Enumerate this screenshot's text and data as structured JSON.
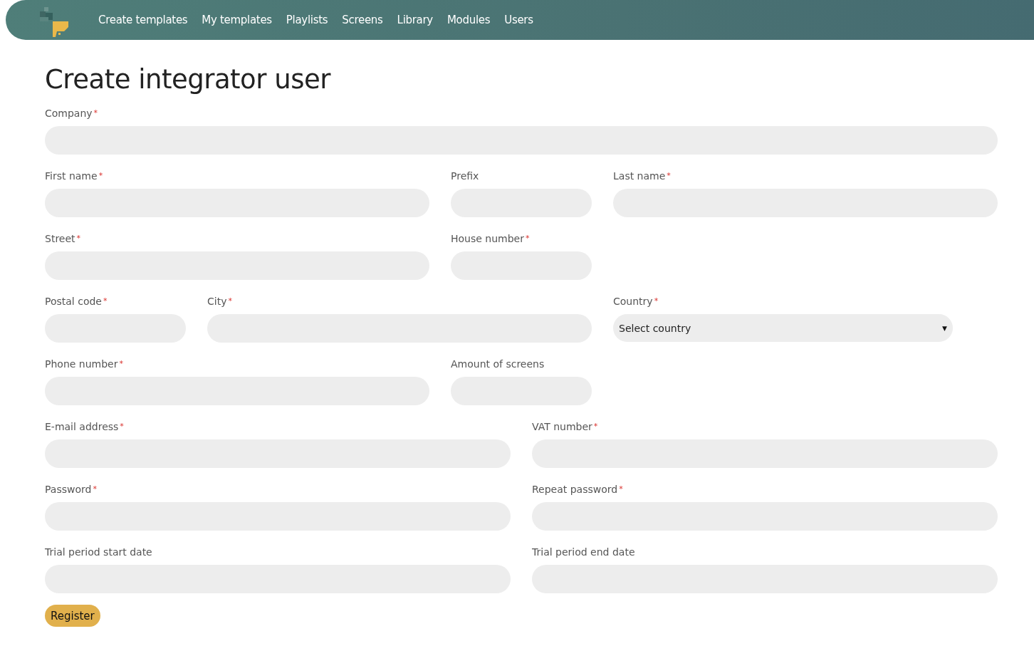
{
  "nav": {
    "items": [
      {
        "label": "Create templates"
      },
      {
        "label": "My templates"
      },
      {
        "label": "Playlists"
      },
      {
        "label": "Screens"
      },
      {
        "label": "Library"
      },
      {
        "label": "Modules"
      },
      {
        "label": "Users"
      }
    ]
  },
  "title": "Create integrator user",
  "required_mark": "*",
  "form_rows": [
    {
      "fields": [
        {
          "label": "Company",
          "required": true,
          "kind": "text"
        }
      ]
    },
    {
      "fields": [
        {
          "label": "First name",
          "required": true,
          "kind": "text"
        },
        {
          "label": "Prefix",
          "required": false,
          "kind": "text"
        },
        {
          "label": "Last name",
          "required": true,
          "kind": "text"
        }
      ]
    },
    {
      "fields": [
        {
          "label": "Street",
          "required": true,
          "kind": "text"
        },
        {
          "label": "House number",
          "required": true,
          "kind": "text"
        }
      ]
    },
    {
      "fields": [
        {
          "label": "Postal code",
          "required": true,
          "kind": "text"
        },
        {
          "label": "City",
          "required": true,
          "kind": "text"
        },
        {
          "label": "Country",
          "required": true,
          "kind": "select",
          "value": "Select country",
          "arrow": "▼"
        }
      ]
    },
    {
      "fields": [
        {
          "label": "Phone number",
          "required": true,
          "kind": "text"
        },
        {
          "label": "Amount of screens",
          "required": false,
          "kind": "text"
        }
      ]
    },
    {
      "fields": [
        {
          "label": "E-mail address",
          "required": true,
          "kind": "text"
        },
        {
          "label": "VAT number",
          "required": true,
          "kind": "text"
        }
      ]
    },
    {
      "fields": [
        {
          "label": "Password",
          "required": true,
          "kind": "password"
        },
        {
          "label": "Repeat password",
          "required": true,
          "kind": "password"
        }
      ]
    },
    {
      "fields": [
        {
          "label": "Trial period start date",
          "required": false,
          "kind": "text"
        },
        {
          "label": "Trial period end date",
          "required": false,
          "kind": "text"
        }
      ]
    }
  ],
  "submit": "Register"
}
